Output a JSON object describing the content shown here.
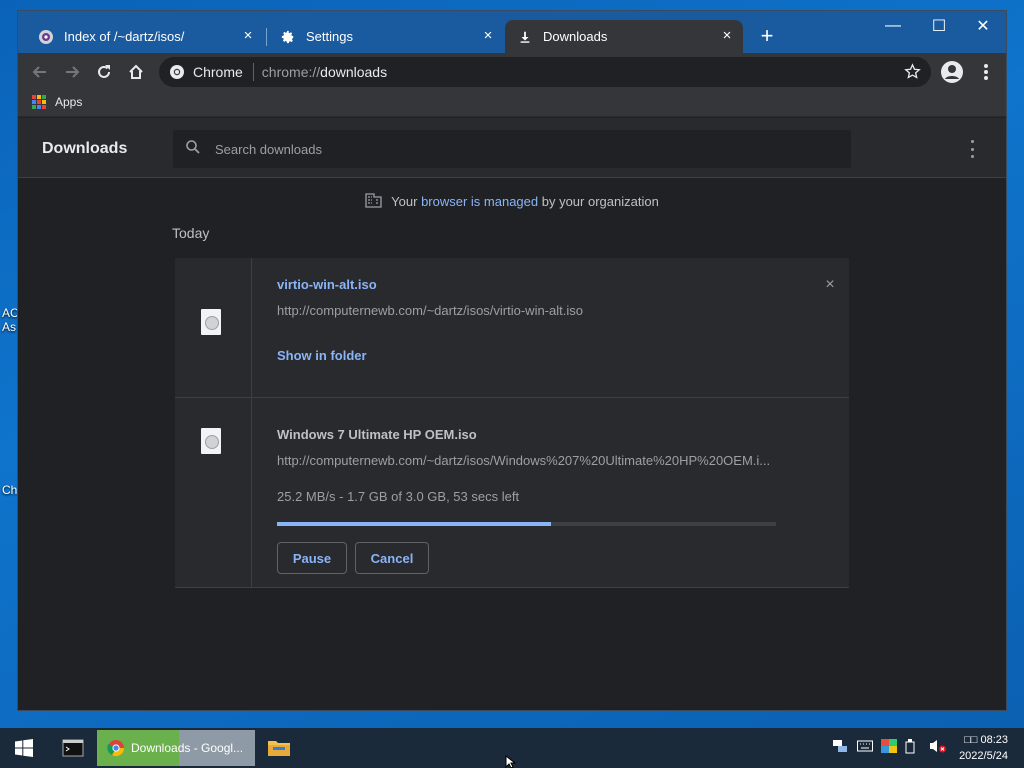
{
  "desktop": {
    "labels": [
      "AC",
      "As",
      "Ch"
    ]
  },
  "tabs": [
    {
      "title": "Index of /~dartz/isos/",
      "icon": "site-favicon",
      "close": "×"
    },
    {
      "title": "Settings",
      "icon": "gear-icon",
      "close": "×"
    },
    {
      "title": "Downloads",
      "icon": "download-icon",
      "close": "×",
      "active": true
    }
  ],
  "window_controls": {
    "minimize": "—",
    "maximize": "☐",
    "close": "✕"
  },
  "new_tab": "+",
  "omnibox": {
    "chip": "Chrome",
    "url_scheme": "chrome://",
    "url_host": "downloads"
  },
  "bookmarks": {
    "apps_label": "Apps"
  },
  "downloads_page": {
    "title": "Downloads",
    "search_placeholder": "Search downloads",
    "managed_prefix": "Your ",
    "managed_link": "browser is managed",
    "managed_suffix": " by your organization",
    "section": "Today",
    "items": [
      {
        "name": "virtio-win-alt.iso",
        "url": "http://computernewb.com/~dartz/isos/virtio-win-alt.iso",
        "action": "Show in folder",
        "dismiss": "×"
      },
      {
        "name": "Windows 7 Ultimate HP OEM.iso",
        "url": "http://computernewb.com/~dartz/isos/Windows%207%20Ultimate%20HP%20OEM.i...",
        "status": "25.2 MB/s - 1.7 GB of 3.0 GB, 53 secs left",
        "progress": 0.55,
        "pause_label": "Pause",
        "cancel_label": "Cancel"
      }
    ]
  },
  "taskbar": {
    "chrome_label": "Downloads - Googl...",
    "clock_time": "□□ 08:23",
    "clock_date": "2022/5/24"
  },
  "colors": {
    "accent": "#8ab4f8",
    "page_bg": "#202124",
    "titlebar": "#1a5a9e"
  }
}
